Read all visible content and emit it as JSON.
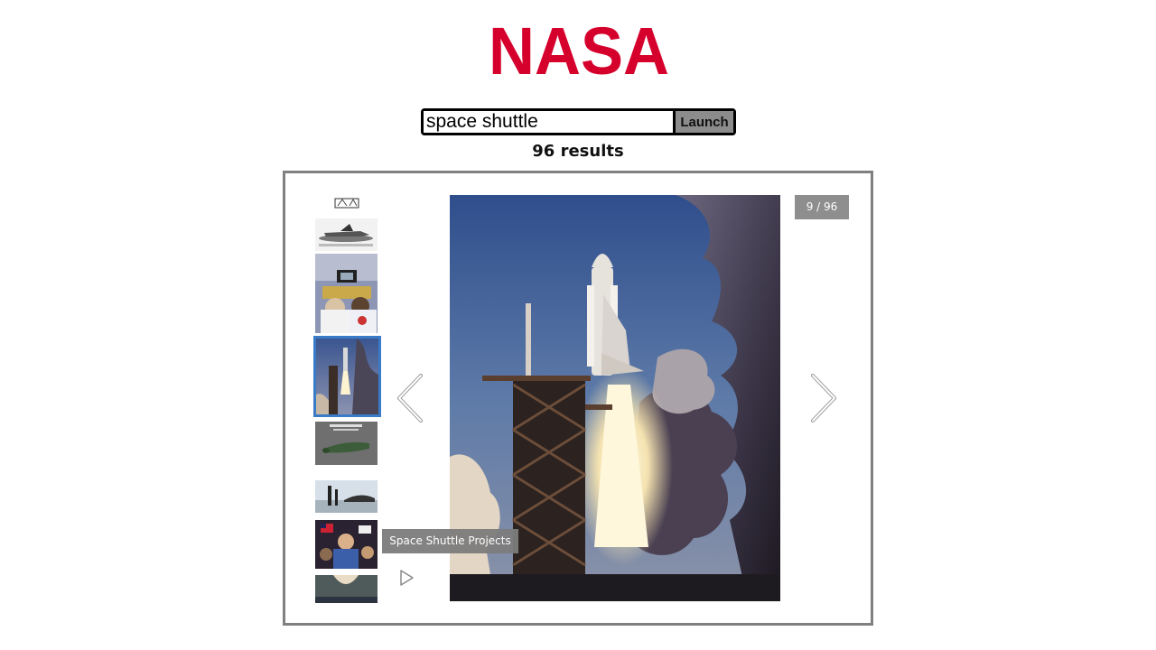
{
  "logo": {
    "text": "NASA",
    "color": "#d5002b"
  },
  "search": {
    "value": "space shuttle",
    "button_label": "Launch"
  },
  "results": {
    "label": "96 results"
  },
  "gallery": {
    "counter": "9 / 96",
    "caption": "Space Shuttle Projects",
    "active_index": 9,
    "total": 96,
    "selection_color": "#3a7bc8",
    "thumbnails": [
      "shuttle-diagram",
      "shuttle-on-carrier",
      "astronauts-at-console",
      "shuttle-launch",
      "external-tank-model",
      "shuttle-rollout-silhouette",
      "crowd-with-flags",
      "aerial-view"
    ],
    "icons": {
      "prev": "chevron-left-icon",
      "next": "chevron-right-icon",
      "play": "play-icon"
    }
  }
}
